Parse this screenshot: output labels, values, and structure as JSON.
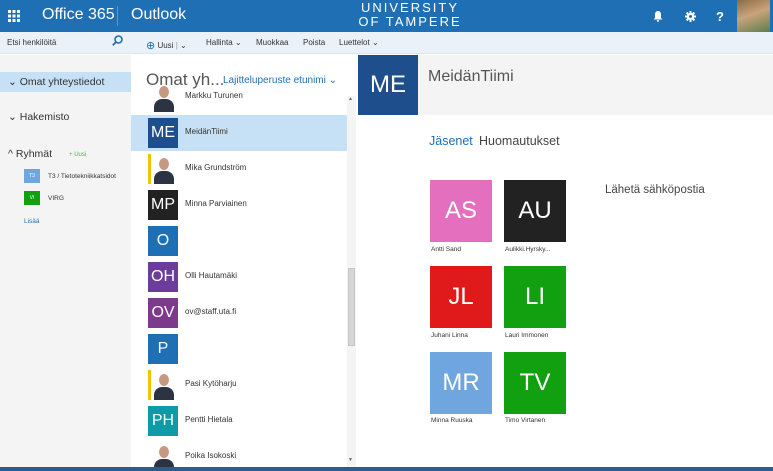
{
  "topbar": {
    "brand": "Office 365",
    "app": "Outlook",
    "university_line1": "UNIVERSITY",
    "university_line2": "OF TAMPERE",
    "icons": [
      "waffle-icon",
      "bell-icon",
      "gear-icon",
      "help-icon"
    ],
    "help_label": "?"
  },
  "toolbar": {
    "search_placeholder": "Etsi henkilöitä",
    "new_label": "Uusi",
    "divider": "|",
    "manage_label": "Hallinta",
    "edit_label": "Muokkaa",
    "delete_label": "Poista",
    "lists_label": "Luettelot"
  },
  "leftnav": {
    "my_contacts": "Omat yhteystiedot",
    "directory": "Hakemisto",
    "groups": "Ryhmät",
    "new_badge": "Uusi",
    "group_items": [
      {
        "initials": "T3",
        "label": "T3 / Tietotekniikkatsidot",
        "color": "#6fa6df"
      },
      {
        "initials": "VI",
        "label": "VIRG",
        "color": "#10a010"
      }
    ],
    "more": "Lisää"
  },
  "list": {
    "title": "Omat yh...",
    "sort_label": "Lajitteluperuste etunimi",
    "contacts": [
      {
        "initials": "",
        "name": "Markku Turunen",
        "kind": "photo"
      },
      {
        "initials": "ME",
        "name": "MeidänTiimi",
        "kind": "tile",
        "color": "#1f4e8c",
        "selected": true
      },
      {
        "initials": "",
        "name": "Mika Grundström",
        "kind": "photo"
      },
      {
        "initials": "MP",
        "name": "Minna Parviainen",
        "kind": "tile",
        "color": "#222222"
      },
      {
        "initials": "O",
        "name": "",
        "kind": "tile",
        "color": "#1f6fb5"
      },
      {
        "initials": "OH",
        "name": "Olli Hautamäki",
        "kind": "tile",
        "color": "#6b3c9a"
      },
      {
        "initials": "OV",
        "name": "ov@staff.uta.fi",
        "kind": "tile",
        "color": "#7d3a8c"
      },
      {
        "initials": "P",
        "name": "",
        "kind": "tile",
        "color": "#1f6fb5"
      },
      {
        "initials": "",
        "name": "Pasi Kytöharju",
        "kind": "photo"
      },
      {
        "initials": "PH",
        "name": "Pentti Hietala",
        "kind": "tile",
        "color": "#0e9aa7"
      },
      {
        "initials": "",
        "name": "Poika Isokoski",
        "kind": "photo"
      }
    ]
  },
  "detail": {
    "initials": "ME",
    "name": "MeidänTiimi",
    "tab_members": "Jäsenet",
    "tab_notes": "Huomautukset",
    "send_email": "Lähetä sähköpostia",
    "members": [
      {
        "initials": "AS",
        "name": "Antti Sand",
        "color": "#e36fbe"
      },
      {
        "initials": "AU",
        "name": "Aulikki.Hyrsky...",
        "color": "#222222"
      },
      {
        "initials": "JL",
        "name": "Juhani Linna",
        "color": "#e01a1a"
      },
      {
        "initials": "LI",
        "name": "Lauri Immonen",
        "color": "#10a010"
      },
      {
        "initials": "MR",
        "name": "Minna Ruuska",
        "color": "#6fa6df"
      },
      {
        "initials": "TV",
        "name": "Timo Virtanen",
        "color": "#10a010"
      }
    ]
  }
}
